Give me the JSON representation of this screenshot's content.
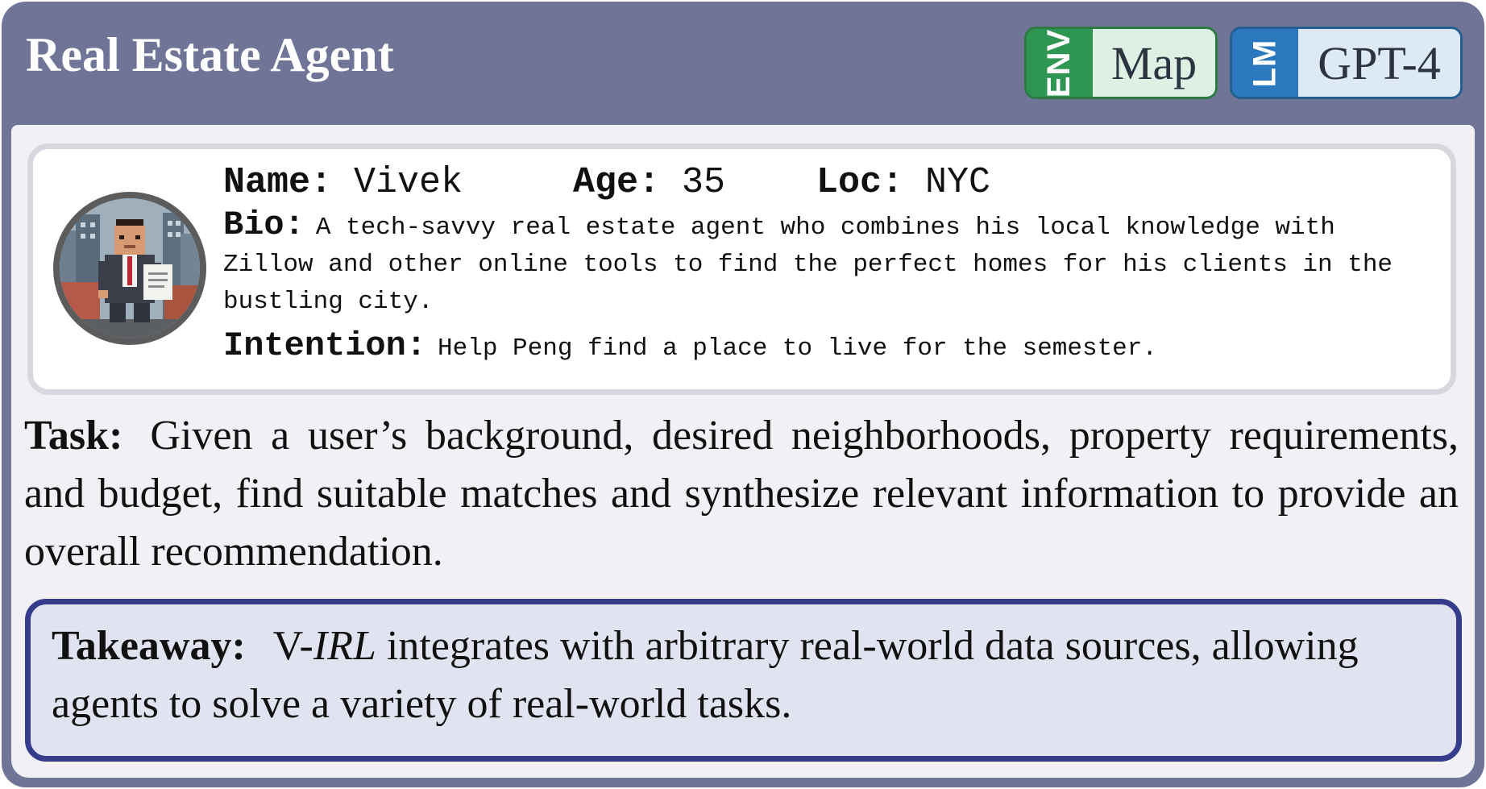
{
  "header": {
    "title": "Real Estate Agent",
    "env_badge": {
      "tag": "ENV",
      "value": "Map",
      "color": "#2f9553"
    },
    "lm_badge": {
      "tag": "LM",
      "value": "GPT-4",
      "color": "#2c78be"
    }
  },
  "profile": {
    "avatar_icon": "pixel-art-agent-avatar-icon",
    "name_label": "Name:",
    "name_value": "Vivek",
    "age_label": "Age:",
    "age_value": "35",
    "loc_label": "Loc:",
    "loc_value": "NYC",
    "bio_label": "Bio:",
    "bio_text": "A tech-savvy real estate agent who combines his local knowledge with Zillow and other online tools to find the perfect homes for his clients in the bustling city.",
    "intention_label": "Intention:",
    "intention_text": "Help Peng find a place to live for the semester."
  },
  "task": {
    "label": "Task:",
    "text": "Given a user’s background, desired neighborhoods, property requirements, and budget, find suitable matches and synthesize relevant information to provide an overall recommendation."
  },
  "takeaway": {
    "label": "Takeaway:",
    "prefix": "V-",
    "emphasis": "IRL",
    "text": " integrates with arbitrary real-world data sources, allowing agents to solve a variety of real-world tasks."
  },
  "colors": {
    "header_bg": "#707497",
    "panel_bg": "#f1f1f5",
    "takeaway_border": "#353c8c",
    "takeaway_bg": "#e1e4f0"
  }
}
